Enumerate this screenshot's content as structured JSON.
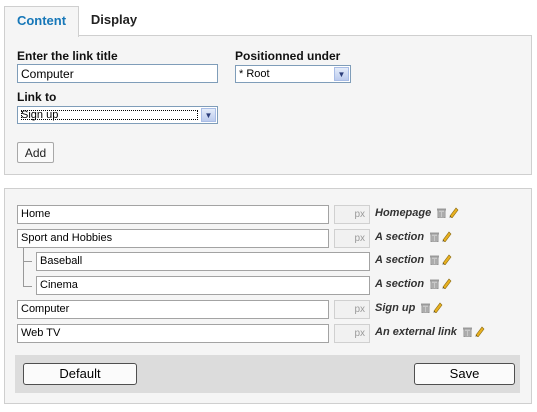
{
  "tabs": [
    {
      "label": "Content",
      "active": true
    },
    {
      "label": "Display",
      "active": false
    }
  ],
  "form": {
    "title_label": "Enter the link title",
    "title_value": "Computer",
    "position_label": "Positionned under",
    "position_value": "* Root",
    "link_label": "Link to",
    "link_value": "Sign up",
    "add_label": "Add"
  },
  "menu_items": [
    {
      "name": "Home",
      "target": "Homepage",
      "px_placeholder": "px",
      "level": 0
    },
    {
      "name": "Sport and Hobbies",
      "target": "A section",
      "px_placeholder": "px",
      "level": 0
    },
    {
      "name": "Baseball",
      "target": "A section",
      "level": 1
    },
    {
      "name": "Cinema",
      "target": "A section",
      "level": 1
    },
    {
      "name": "Computer",
      "target": "Sign up",
      "px_placeholder": "px",
      "level": 0
    },
    {
      "name": "Web TV",
      "target": "An external link",
      "px_placeholder": "px",
      "level": 0
    }
  ],
  "icons": {
    "delete": "trash-icon",
    "edit": "pencil-icon"
  },
  "colors": {
    "accent": "#1677b8",
    "pencil": "#e8b020"
  },
  "footer": {
    "default_label": "Default",
    "save_label": "Save"
  }
}
